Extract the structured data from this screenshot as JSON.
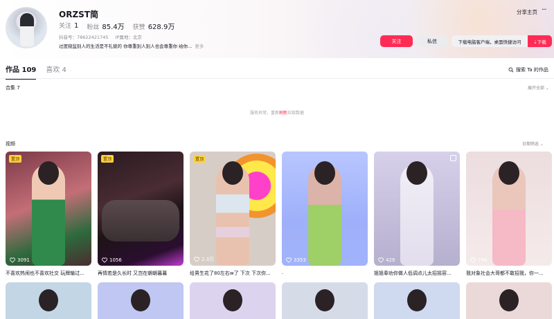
{
  "profile": {
    "nickname": "ORZST简",
    "following_label": "关注",
    "following_count": "1",
    "followers_label": "粉丝",
    "followers_count": "85.4万",
    "likes_label": "获赞",
    "likes_count": "628.9万",
    "douyin_id": "抖音号：78622421745",
    "ip_location": "IP属地：北京",
    "bio": "过度窥监别人的生活是不礼貌的 你尊重别人别人也会尊重你 给你...",
    "more_label": "更多"
  },
  "header_actions": {
    "share_label": "分享主页",
    "more_icon": "···",
    "follow_label": "关注",
    "message_label": "私信",
    "download_hint": "下载电脑客户端，桌面快捷访问",
    "download_label": "⇣下载"
  },
  "tabs": [
    {
      "label": "作品 109",
      "active": true
    },
    {
      "label": "喜欢 4",
      "active": false
    }
  ],
  "search_works_label": "搜索 Ta 的作品",
  "collection": {
    "label": "合集 7",
    "expand_label": "展开全部 ⌄",
    "error_prefix": "服务异常，重新",
    "refresh_label": "刷新",
    "error_suffix": "拉取数据"
  },
  "videos_section": {
    "label": "视频",
    "date_filter_label": "日期筛选 ⌄"
  },
  "videos": [
    {
      "likes": "3091",
      "caption": "不喜欢热闹也不喜欢社交 玩牌输过...",
      "pinned_label": "置顶"
    },
    {
      "likes": "1056",
      "caption": "再情若是久长时 又岂在朝朝暮暮",
      "pinned_label": "置顶"
    },
    {
      "likes": "2.3万",
      "caption": "给男生花了80左右w了 下次 下次你...",
      "pinned_label": "置顶"
    },
    {
      "likes": "3353",
      "caption": ".",
      "pinned_label": ""
    },
    {
      "likes": "429",
      "caption": "姐姐奉劝你做人低调点儿太招摇容...",
      "pinned_label": ""
    },
    {
      "likes": "794",
      "caption": "我对象社会大哥都不敢招我，你一...",
      "pinned_label": ""
    }
  ],
  "colors": {
    "accent": "#fe2c55",
    "text_primary": "#161823",
    "text_secondary": "#8a8b91",
    "pinned_badge": "#ffd23b"
  }
}
